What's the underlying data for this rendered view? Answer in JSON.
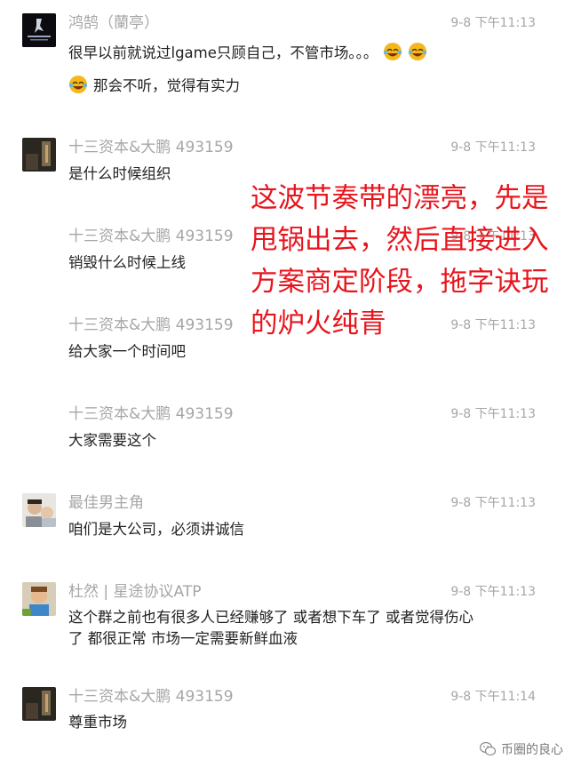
{
  "messages": [
    {
      "name": "鸿鹄（蘭亭）",
      "time": "9-8 下午11:13",
      "lines": [
        "很早以前就说过lgame只顾自己，不管市场。。。"
      ],
      "line2": "那会不听，觉得有实力",
      "avatar": "black-logo"
    },
    {
      "name": "十三资本&大鹏 493159",
      "time": "9-8 下午11:13",
      "lines": [
        "是什么时候组织"
      ],
      "avatar": "dark-photo"
    },
    {
      "name": "十三资本&大鹏 493159",
      "time": "9-8 下午11:13",
      "lines": [
        "销毁什么时候上线"
      ]
    },
    {
      "name": "十三资本&大鹏 493159",
      "time": "9-8 下午11:13",
      "lines": [
        "给大家一个时间吧"
      ]
    },
    {
      "name": "十三资本&大鹏 493159",
      "time": "9-8 下午11:13",
      "lines": [
        "大家需要这个"
      ]
    },
    {
      "name": "最佳男主角",
      "time": "9-8 下午11:13",
      "lines": [
        "咱们是大公司，必须讲诚信"
      ],
      "avatar": "light-photo"
    },
    {
      "name": "杜然 | 星途协议ATP",
      "time": "9-8 下午11:13",
      "lines": [
        "这个群之前也有很多人已经赚够了 或者想下车了 或者觉得伤心",
        "了 都很正常 市场一定需要新鲜血液"
      ],
      "avatar": "child-photo"
    },
    {
      "name": "十三资本&大鹏 493159",
      "time": "9-8 下午11:14",
      "lines": [
        "尊重市场"
      ],
      "avatar": "dark-photo"
    }
  ],
  "overlay_lines": [
    "这波节奏带的漂亮，先是",
    "甩锅出去，然后直接进入",
    "方案商定阶段，拖字诀玩",
    "的炉火纯青"
  ],
  "watermark": "币圈的良心",
  "colors": {
    "name": "#a6a6a6",
    "text": "#222222",
    "overlay": "#e8141c"
  }
}
